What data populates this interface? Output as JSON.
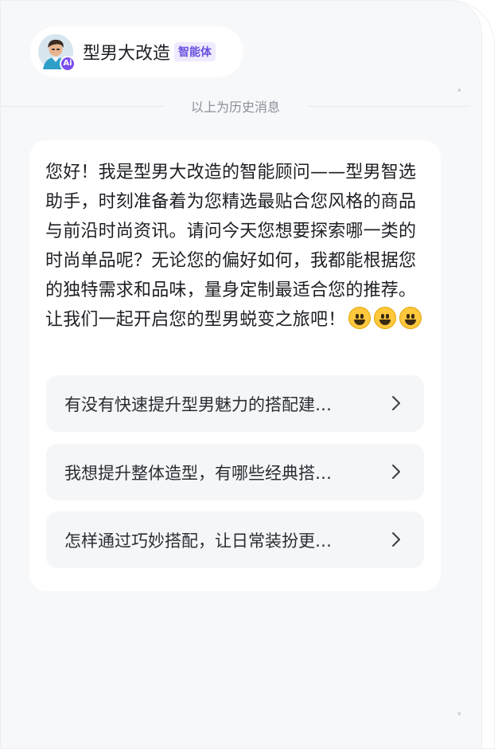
{
  "header": {
    "agent_name": "型男大改造",
    "agent_tag": "智能体",
    "avatar_icon": "cartoon-man-avatar",
    "avatar_badge": "Ai"
  },
  "divider": {
    "text": "以上为历史消息"
  },
  "message": {
    "greeting": "您好！我是型男大改造的智能顾问——型男智选助手，时刻准备着为您精选最贴合您风格的商品与前沿时尚资讯。请问今天您想要探索哪一类的时尚单品呢？无论您的偏好如何，我都能根据您的独特需求和品味，量身定制最适合您的推荐。让我们一起开启您的型男蜕变之旅吧！",
    "emojis": [
      "grinning-face-icon",
      "grinning-face-icon",
      "grinning-face-icon"
    ]
  },
  "suggestions": [
    {
      "label": "有没有快速提升型男魅力的搭配建…"
    },
    {
      "label": "我想提升整体造型，有哪些经典搭…"
    },
    {
      "label": "怎样通过巧妙搭配，让日常装扮更…"
    }
  ],
  "colors": {
    "accent": "#7a4ff0",
    "background": "#f7f8fa",
    "card": "#ffffff"
  }
}
